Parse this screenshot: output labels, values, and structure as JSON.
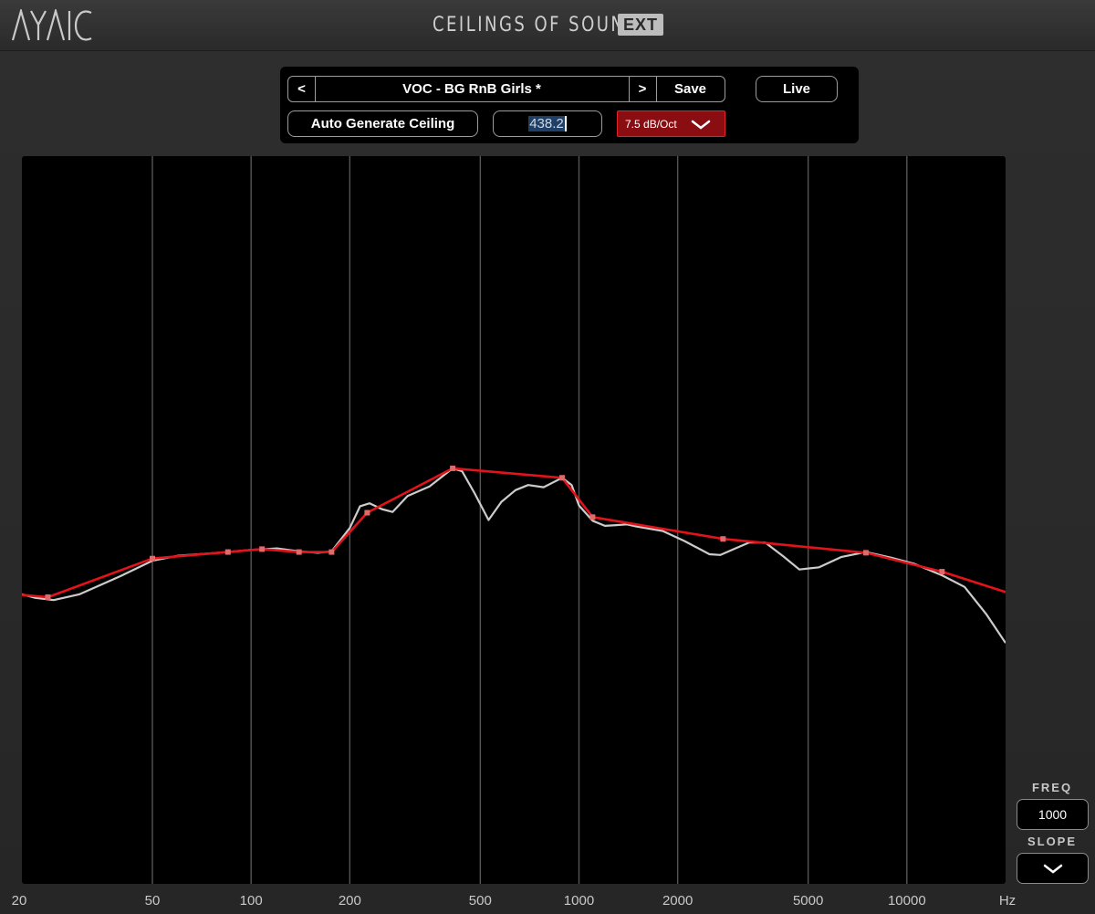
{
  "header": {
    "logo_text": "AYAIC",
    "title": "CEILINGS OF SOUND",
    "badge": "EXT"
  },
  "controls": {
    "prev_label": "<",
    "preset_name": "VOC - BG RnB Girls *",
    "next_label": ">",
    "save_label": "Save",
    "live_label": "Live",
    "auto_generate_label": "Auto Generate Ceiling",
    "frequency_value": "438.2",
    "slope_value": "7.5 dB/Oct"
  },
  "side_panel": {
    "freq_label": "FREQ",
    "freq_value": "1000",
    "slope_label": "SLOPE"
  },
  "chart_data": {
    "type": "line",
    "x_scale": "log",
    "x_range": [
      20,
      20000
    ],
    "x_unit": "Hz",
    "x_ticks": [
      {
        "label": "20",
        "value": 20
      },
      {
        "label": "50",
        "value": 50
      },
      {
        "label": "100",
        "value": 100
      },
      {
        "label": "200",
        "value": 200
      },
      {
        "label": "500",
        "value": 500
      },
      {
        "label": "1000",
        "value": 1000
      },
      {
        "label": "2000",
        "value": 2000
      },
      {
        "label": "5000",
        "value": 5000
      },
      {
        "label": "10000",
        "value": 10000
      },
      {
        "label": "Hz",
        "value": 20000
      }
    ],
    "gridlines_hz": [
      50,
      100,
      200,
      500,
      1000,
      2000,
      5000,
      10000
    ],
    "y_range": [
      0,
      1
    ],
    "grid": true,
    "colors": {
      "ceiling": "#e3121b",
      "spectrum": "#cccccc",
      "background": "#000000",
      "grid": "#555555"
    },
    "series": [
      {
        "role": "ceiling",
        "points": [
          [
            20,
            0.397
          ],
          [
            24,
            0.394
          ],
          [
            50,
            0.447
          ],
          [
            85,
            0.456
          ],
          [
            108,
            0.46
          ],
          [
            140,
            0.456
          ],
          [
            176,
            0.456
          ],
          [
            226,
            0.51
          ],
          [
            412,
            0.571
          ],
          [
            888,
            0.558
          ],
          [
            1100,
            0.504
          ],
          [
            2750,
            0.474
          ],
          [
            7500,
            0.455
          ],
          [
            12800,
            0.429
          ],
          [
            20000,
            0.401
          ]
        ]
      },
      {
        "role": "spectrum",
        "points": [
          [
            20,
            0.398
          ],
          [
            22,
            0.393
          ],
          [
            25,
            0.39
          ],
          [
            30,
            0.398
          ],
          [
            40,
            0.423
          ],
          [
            50,
            0.444
          ],
          [
            60,
            0.451
          ],
          [
            80,
            0.455
          ],
          [
            100,
            0.459
          ],
          [
            120,
            0.461
          ],
          [
            140,
            0.457
          ],
          [
            160,
            0.455
          ],
          [
            176,
            0.457
          ],
          [
            200,
            0.489
          ],
          [
            215,
            0.519
          ],
          [
            230,
            0.523
          ],
          [
            250,
            0.515
          ],
          [
            270,
            0.511
          ],
          [
            300,
            0.533
          ],
          [
            350,
            0.546
          ],
          [
            412,
            0.571
          ],
          [
            440,
            0.567
          ],
          [
            480,
            0.537
          ],
          [
            530,
            0.5
          ],
          [
            580,
            0.525
          ],
          [
            640,
            0.541
          ],
          [
            700,
            0.548
          ],
          [
            780,
            0.545
          ],
          [
            888,
            0.558
          ],
          [
            950,
            0.548
          ],
          [
            1000,
            0.52
          ],
          [
            1100,
            0.499
          ],
          [
            1200,
            0.492
          ],
          [
            1300,
            0.493
          ],
          [
            1400,
            0.494
          ],
          [
            1500,
            0.491
          ],
          [
            1800,
            0.485
          ],
          [
            2100,
            0.471
          ],
          [
            2500,
            0.453
          ],
          [
            2700,
            0.452
          ],
          [
            3000,
            0.461
          ],
          [
            3300,
            0.469
          ],
          [
            3700,
            0.469
          ],
          [
            4200,
            0.45
          ],
          [
            4700,
            0.432
          ],
          [
            5400,
            0.435
          ],
          [
            6300,
            0.449
          ],
          [
            7500,
            0.456
          ],
          [
            9000,
            0.448
          ],
          [
            10500,
            0.44
          ],
          [
            12800,
            0.424
          ],
          [
            15000,
            0.408
          ],
          [
            17500,
            0.37
          ],
          [
            20000,
            0.331
          ]
        ]
      }
    ]
  }
}
